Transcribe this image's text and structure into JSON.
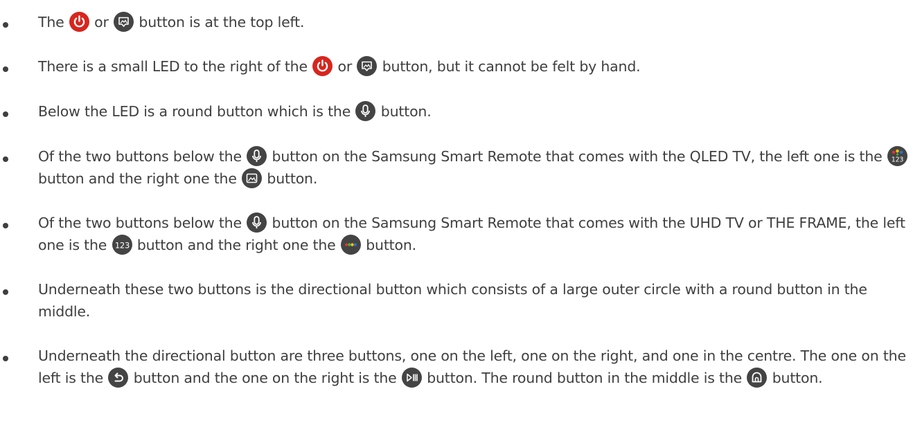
{
  "bullets": [
    {
      "p1": "The ",
      "p2": " or ",
      "p3": " button is at the top left."
    },
    {
      "p1": "There is a small LED to the right of the ",
      "p2": " or ",
      "p3": " button, but it cannot be felt by hand."
    },
    {
      "p1": "Below the LED is a round button which is the ",
      "p2": " button."
    },
    {
      "p1": "Of the two buttons below the ",
      "p2": " button on the Samsung Smart Remote that comes with the QLED TV, the left one is the ",
      "p3": " button and the right one the ",
      "p4": " button."
    },
    {
      "p1": "Of the two buttons below the ",
      "p2": " button on the Samsung Smart Remote that comes with the UHD TV or THE FRAME, the left one is the ",
      "p3": " button and the right one the ",
      "p4": " button."
    },
    {
      "p1": "Underneath these two buttons is the directional button which consists of a large outer circle with a round button in the middle."
    },
    {
      "p1": "Underneath the directional button are three buttons, one on the left, one on the right, and one in the centre. The one on the left is the ",
      "p2": " button and the one on the right is the ",
      "p3": " button. The round button in the middle is the ",
      "p4": " button."
    }
  ],
  "icons": {
    "power": "power-icon",
    "ambient": "ambient-mode-icon",
    "mic": "microphone-icon",
    "color_123": "color-123-icon",
    "ambient_square": "ambient-frame-icon",
    "number_123": "number-123-icon",
    "color_dots": "color-dots-icon",
    "back": "return-icon",
    "play_pause": "play-pause-icon",
    "home": "home-icon",
    "digits": "123"
  },
  "colors": {
    "text": "#3f3f3f",
    "icon_dark": "#444444",
    "power_red": "#d6261e",
    "dot_red": "#e0342b",
    "dot_yellow": "#f2c200",
    "dot_green": "#3bb143",
    "dot_blue": "#2f6fd1"
  }
}
